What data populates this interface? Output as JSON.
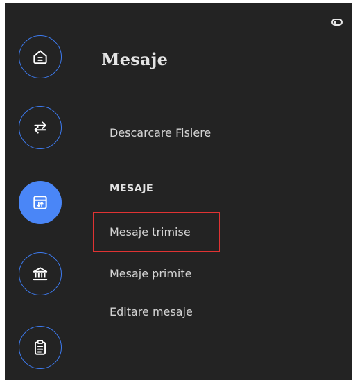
{
  "header": {
    "title": "Mesaje"
  },
  "rail": {
    "buttons": [
      {
        "icon": "home-icon"
      },
      {
        "icon": "transfer-icon"
      },
      {
        "icon": "messages-icon",
        "active": true
      },
      {
        "icon": "bank-icon"
      },
      {
        "icon": "clipboard-icon"
      }
    ]
  },
  "menu": {
    "top_item": "Descarcare Fisiere",
    "section_title": "MESAJE",
    "items": [
      {
        "label": "Mesaje trimise",
        "highlighted": true
      },
      {
        "label": "Mesaje primite"
      },
      {
        "label": "Editare mesaje"
      }
    ]
  },
  "colors": {
    "background": "#232323",
    "accent": "#4a86f7",
    "highlight_border": "#e03333"
  }
}
